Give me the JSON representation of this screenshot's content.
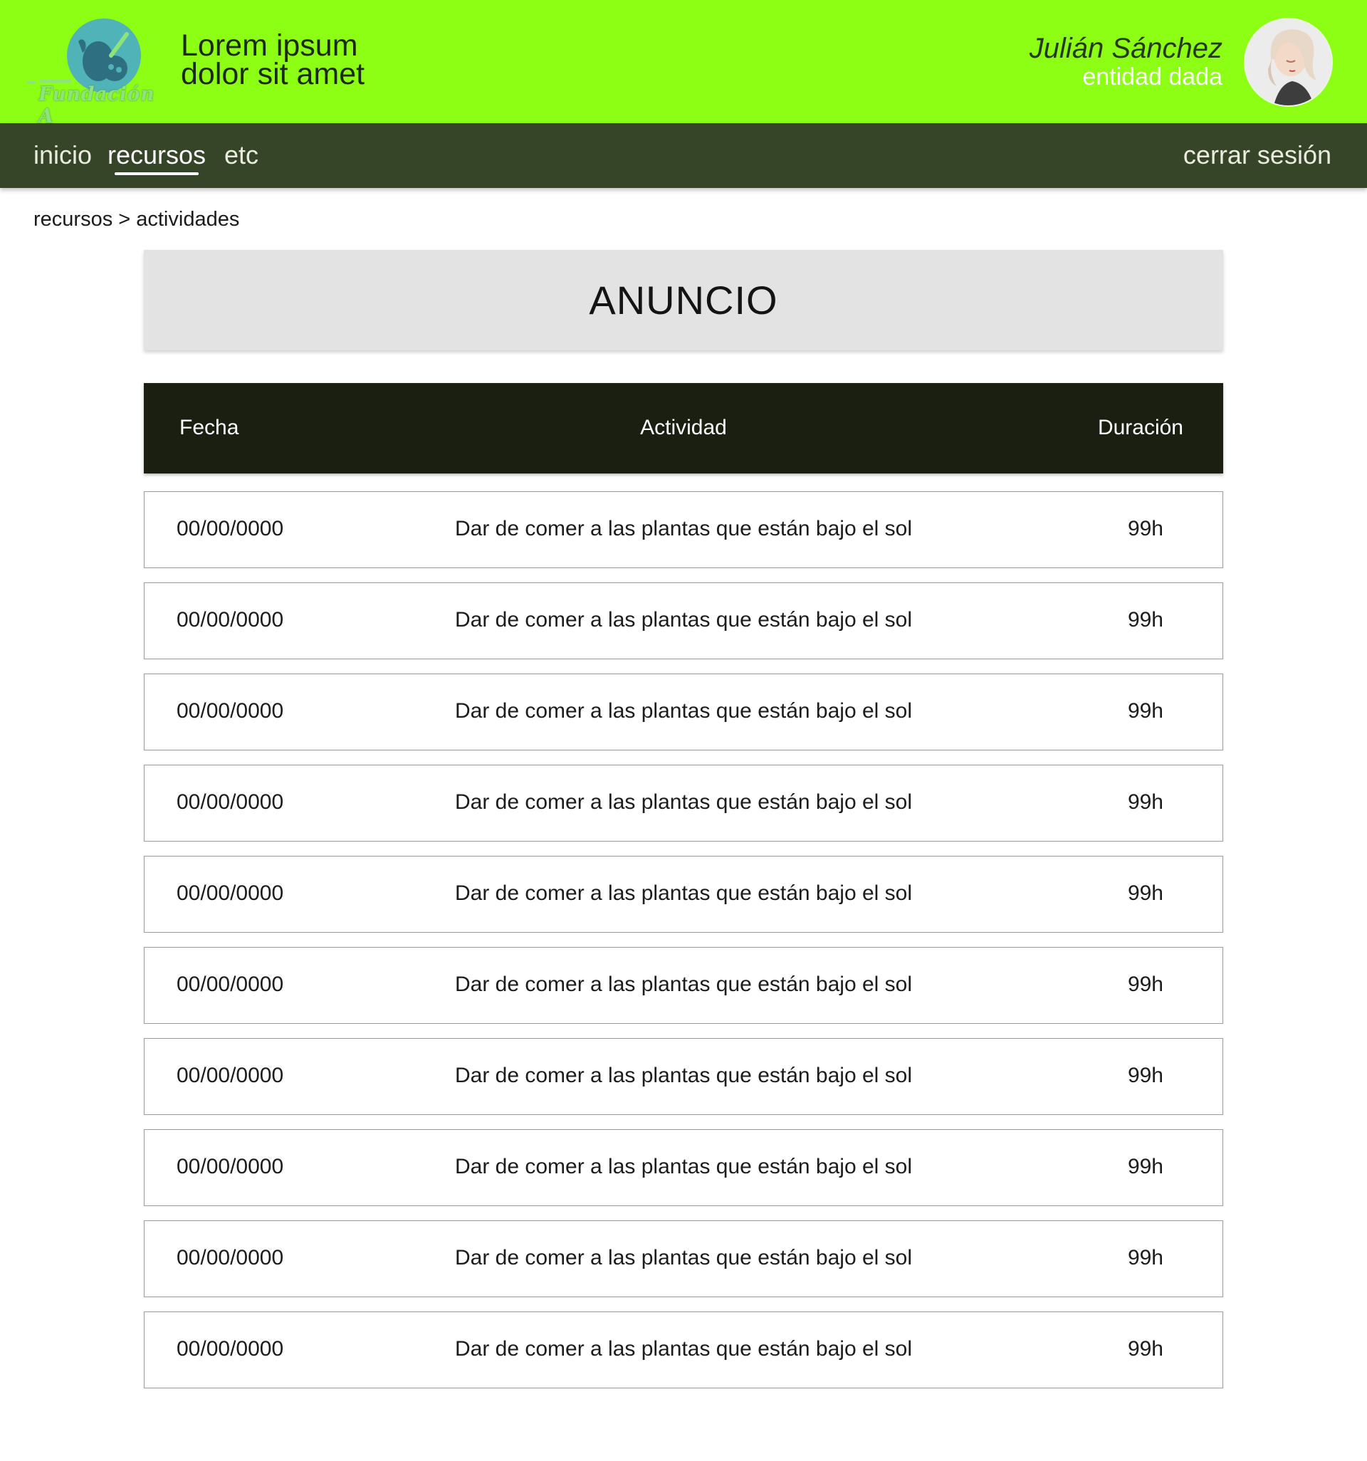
{
  "header": {
    "logo_text": "Fundación A",
    "title_line1": "Lorem ipsum",
    "title_line2": "dolor sit amet",
    "user_name": "Julián Sánchez",
    "user_entity": "entidad dada",
    "brand_color": "#8cff14"
  },
  "nav": {
    "items": [
      {
        "label": "inicio",
        "active": false
      },
      {
        "label": "recursos",
        "active": true
      },
      {
        "label": "etc",
        "active": false
      }
    ],
    "logout": "cerrar sesión",
    "bar_color": "#364428"
  },
  "breadcrumb": "recursos > actividades",
  "banner": {
    "text": "ANUNCIO"
  },
  "table": {
    "columns": [
      "Fecha",
      "Actividad",
      "Duración"
    ],
    "rows": [
      {
        "fecha": "00/00/0000",
        "actividad": "Dar de comer a las plantas que están bajo el sol",
        "duracion": "99h"
      },
      {
        "fecha": "00/00/0000",
        "actividad": "Dar de comer a las plantas que están bajo el sol",
        "duracion": "99h"
      },
      {
        "fecha": "00/00/0000",
        "actividad": "Dar de comer a las plantas que están bajo el sol",
        "duracion": "99h"
      },
      {
        "fecha": "00/00/0000",
        "actividad": "Dar de comer a las plantas que están bajo el sol",
        "duracion": "99h"
      },
      {
        "fecha": "00/00/0000",
        "actividad": "Dar de comer a las plantas que están bajo el sol",
        "duracion": "99h"
      },
      {
        "fecha": "00/00/0000",
        "actividad": "Dar de comer a las plantas que están bajo el sol",
        "duracion": "99h"
      },
      {
        "fecha": "00/00/0000",
        "actividad": "Dar de comer a las plantas que están bajo el sol",
        "duracion": "99h"
      },
      {
        "fecha": "00/00/0000",
        "actividad": "Dar de comer a las plantas que están bajo el sol",
        "duracion": "99h"
      },
      {
        "fecha": "00/00/0000",
        "actividad": "Dar de comer a las plantas que están bajo el sol",
        "duracion": "99h"
      },
      {
        "fecha": "00/00/0000",
        "actividad": "Dar de comer a las plantas que están bajo el sol",
        "duracion": "99h"
      }
    ]
  }
}
